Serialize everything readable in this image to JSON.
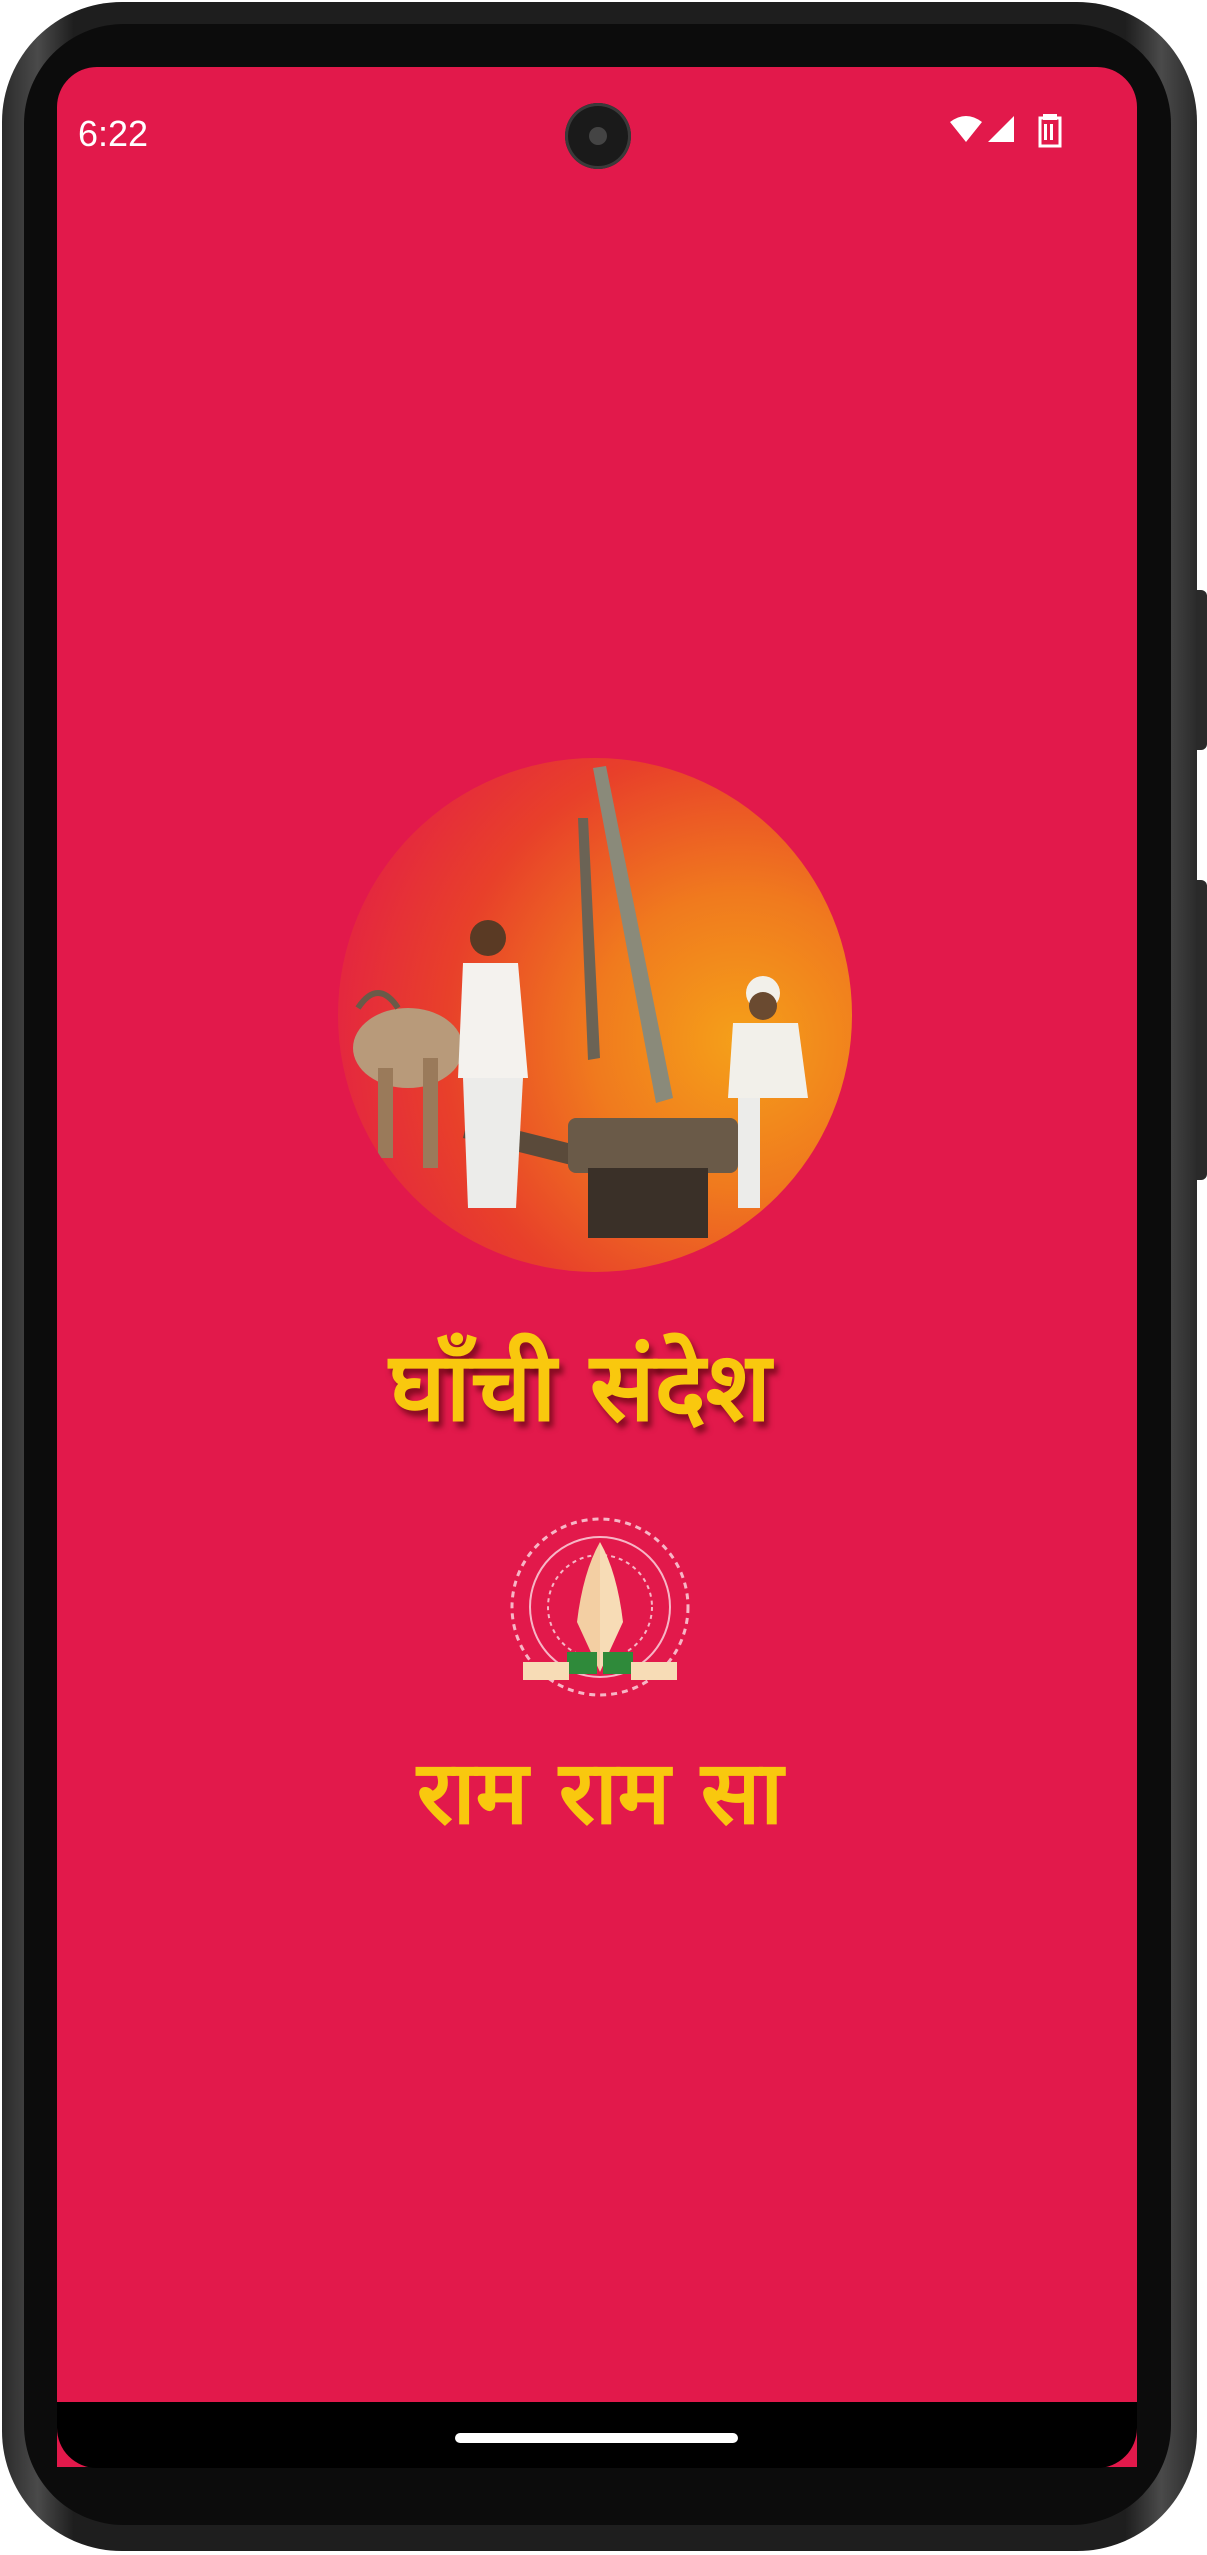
{
  "status_bar": {
    "time": "6:22",
    "icons": [
      "wifi-icon",
      "signal-icon",
      "battery-icon"
    ]
  },
  "splash": {
    "logo_image": "oil-press-bullock-logo",
    "title": "घाँची संदेश",
    "namaste_icon": "namaste-hands-icon",
    "greeting": "राम राम सा"
  },
  "colors": {
    "background": "#E2194B",
    "title_text": "#F9C80E",
    "logo_gradient_start": "#E2194B",
    "logo_gradient_end": "#F5A019"
  }
}
